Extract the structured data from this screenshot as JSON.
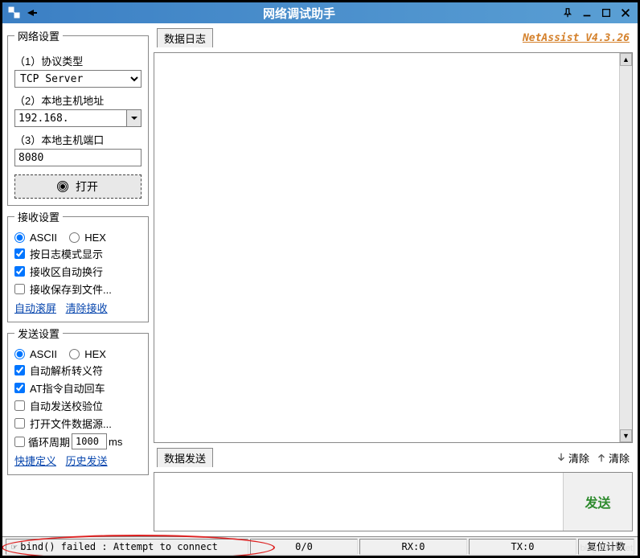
{
  "title": "网络调试助手",
  "brand": "NetAssist V4.3.26",
  "network": {
    "legend": "网络设置",
    "protocol_label": "（1）协议类型",
    "protocol_value": "TCP Server",
    "host_label": "（2）本地主机地址",
    "host_value": "192.168.",
    "port_label": "（3）本地主机端口",
    "port_value": "8080",
    "open_label": "打开"
  },
  "recv": {
    "legend": "接收设置",
    "ascii": "ASCII",
    "hex": "HEX",
    "log_mode": "按日志模式显示",
    "auto_wrap": "接收区自动换行",
    "save_file": "接收保存到文件...",
    "autoscroll": "自动滚屏",
    "clear_recv": "清除接收"
  },
  "send": {
    "legend": "发送设置",
    "ascii": "ASCII",
    "hex": "HEX",
    "escape": "自动解析转义符",
    "at_return": "AT指令自动回车",
    "checksum": "自动发送校验位",
    "open_file": "打开文件数据源...",
    "cycle_label": "循环周期",
    "cycle_value": "1000",
    "cycle_unit": "ms",
    "quick_def": "快捷定义",
    "history": "历史发送"
  },
  "log_label": "数据日志",
  "sendbox": {
    "label": "数据发送",
    "clear1": "清除",
    "clear2": "清除",
    "send_btn": "发送"
  },
  "status": {
    "msg": "bind() failed : Attempt to connect",
    "count": "0/0",
    "rx": "RX:0",
    "tx": "TX:0",
    "reset": "复位计数"
  }
}
